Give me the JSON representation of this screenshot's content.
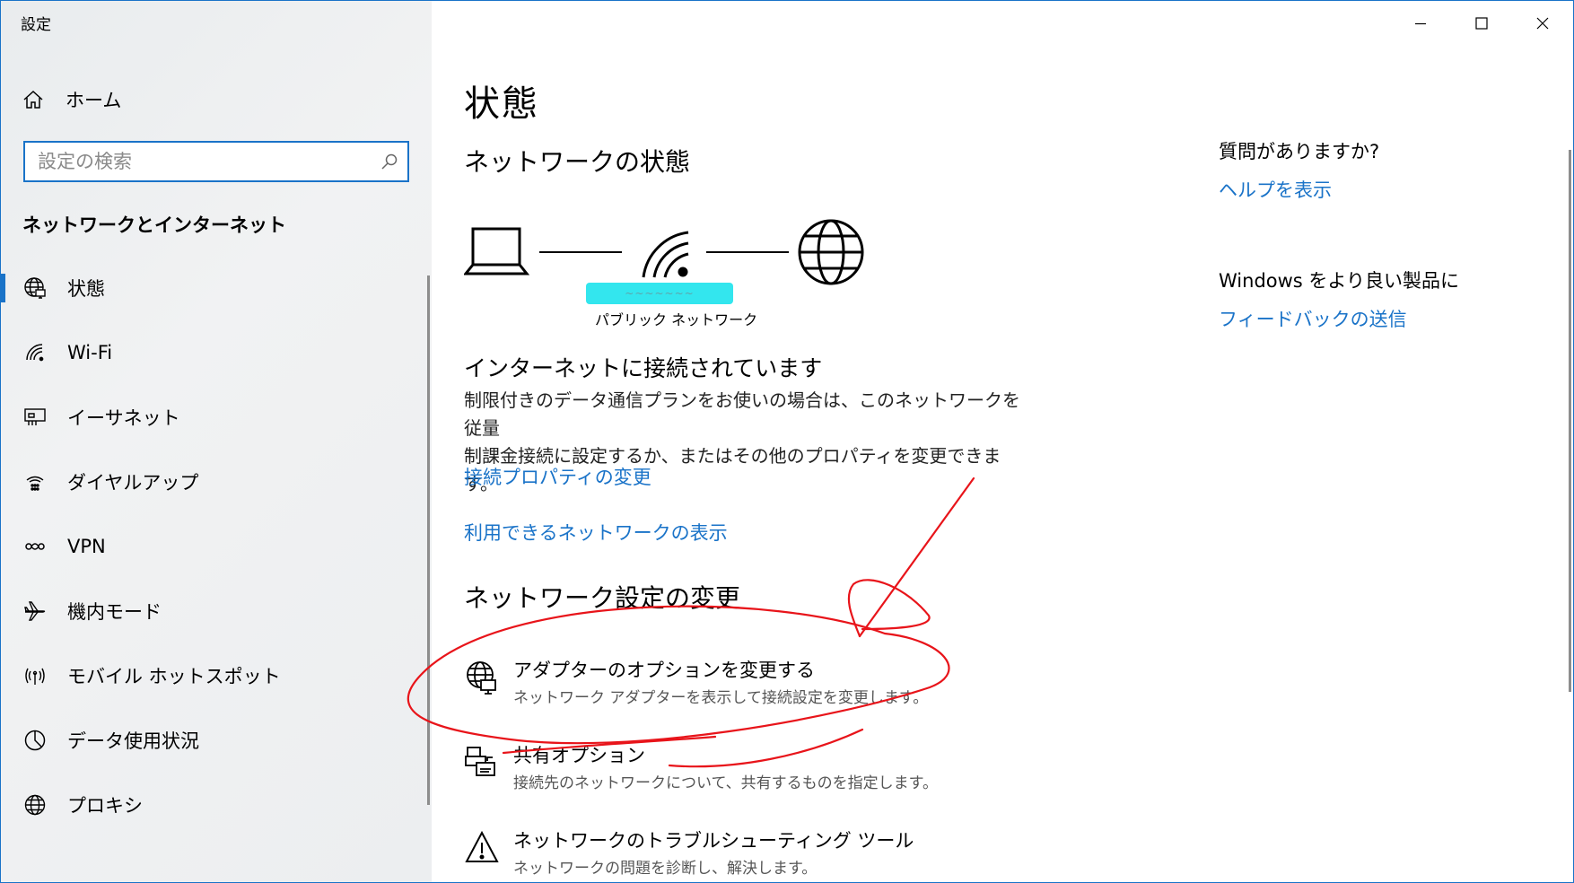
{
  "app": {
    "title": "設定"
  },
  "sidebar": {
    "home_label": "ホーム",
    "search_placeholder": "設定の検索",
    "section_title": "ネットワークとインターネット",
    "items": [
      {
        "label": "状態",
        "icon": "globe-pc-icon",
        "active": true
      },
      {
        "label": "Wi-Fi",
        "icon": "wifi-icon"
      },
      {
        "label": "イーサネット",
        "icon": "ethernet-icon"
      },
      {
        "label": "ダイヤルアップ",
        "icon": "dialup-icon"
      },
      {
        "label": "VPN",
        "icon": "vpn-icon"
      },
      {
        "label": "機内モード",
        "icon": "airplane-icon"
      },
      {
        "label": "モバイル ホットスポット",
        "icon": "hotspot-icon"
      },
      {
        "label": "データ使用状況",
        "icon": "data-usage-icon"
      },
      {
        "label": "プロキシ",
        "icon": "globe-icon"
      }
    ]
  },
  "main": {
    "page_title": "状態",
    "network_status_title": "ネットワークの状態",
    "network_type": "パブリック ネットワーク",
    "connection_title": "インターネットに接続されています",
    "connection_desc_1": "制限付きのデータ通信プランをお使いの場合は、このネットワークを従量",
    "connection_desc_2": "制課金接続に設定するか、またはその他のプロパティを変更できます。",
    "link_properties": "接続プロパティの変更",
    "link_available": "利用できるネットワークの表示",
    "change_settings_title": "ネットワーク設定の変更",
    "options": [
      {
        "title": "アダプターのオプションを変更する",
        "desc": "ネットワーク アダプターを表示して接続設定を変更します。",
        "icon": "adapter-icon"
      },
      {
        "title": "共有オプション",
        "desc": "接続先のネットワークについて、共有するものを指定します。",
        "icon": "sharing-icon"
      },
      {
        "title": "ネットワークのトラブルシューティング ツール",
        "desc": "ネットワークの問題を診断し、解決します。",
        "icon": "warning-icon"
      }
    ]
  },
  "right": {
    "question_title": "質問がありますか?",
    "help_link": "ヘルプを表示",
    "feedback_title": "Windows をより良い製品に",
    "feedback_link": "フィードバックの送信"
  },
  "colors": {
    "accent": "#1a73c8",
    "annotation": "#e8141a",
    "highlight": "#33e6ee"
  }
}
